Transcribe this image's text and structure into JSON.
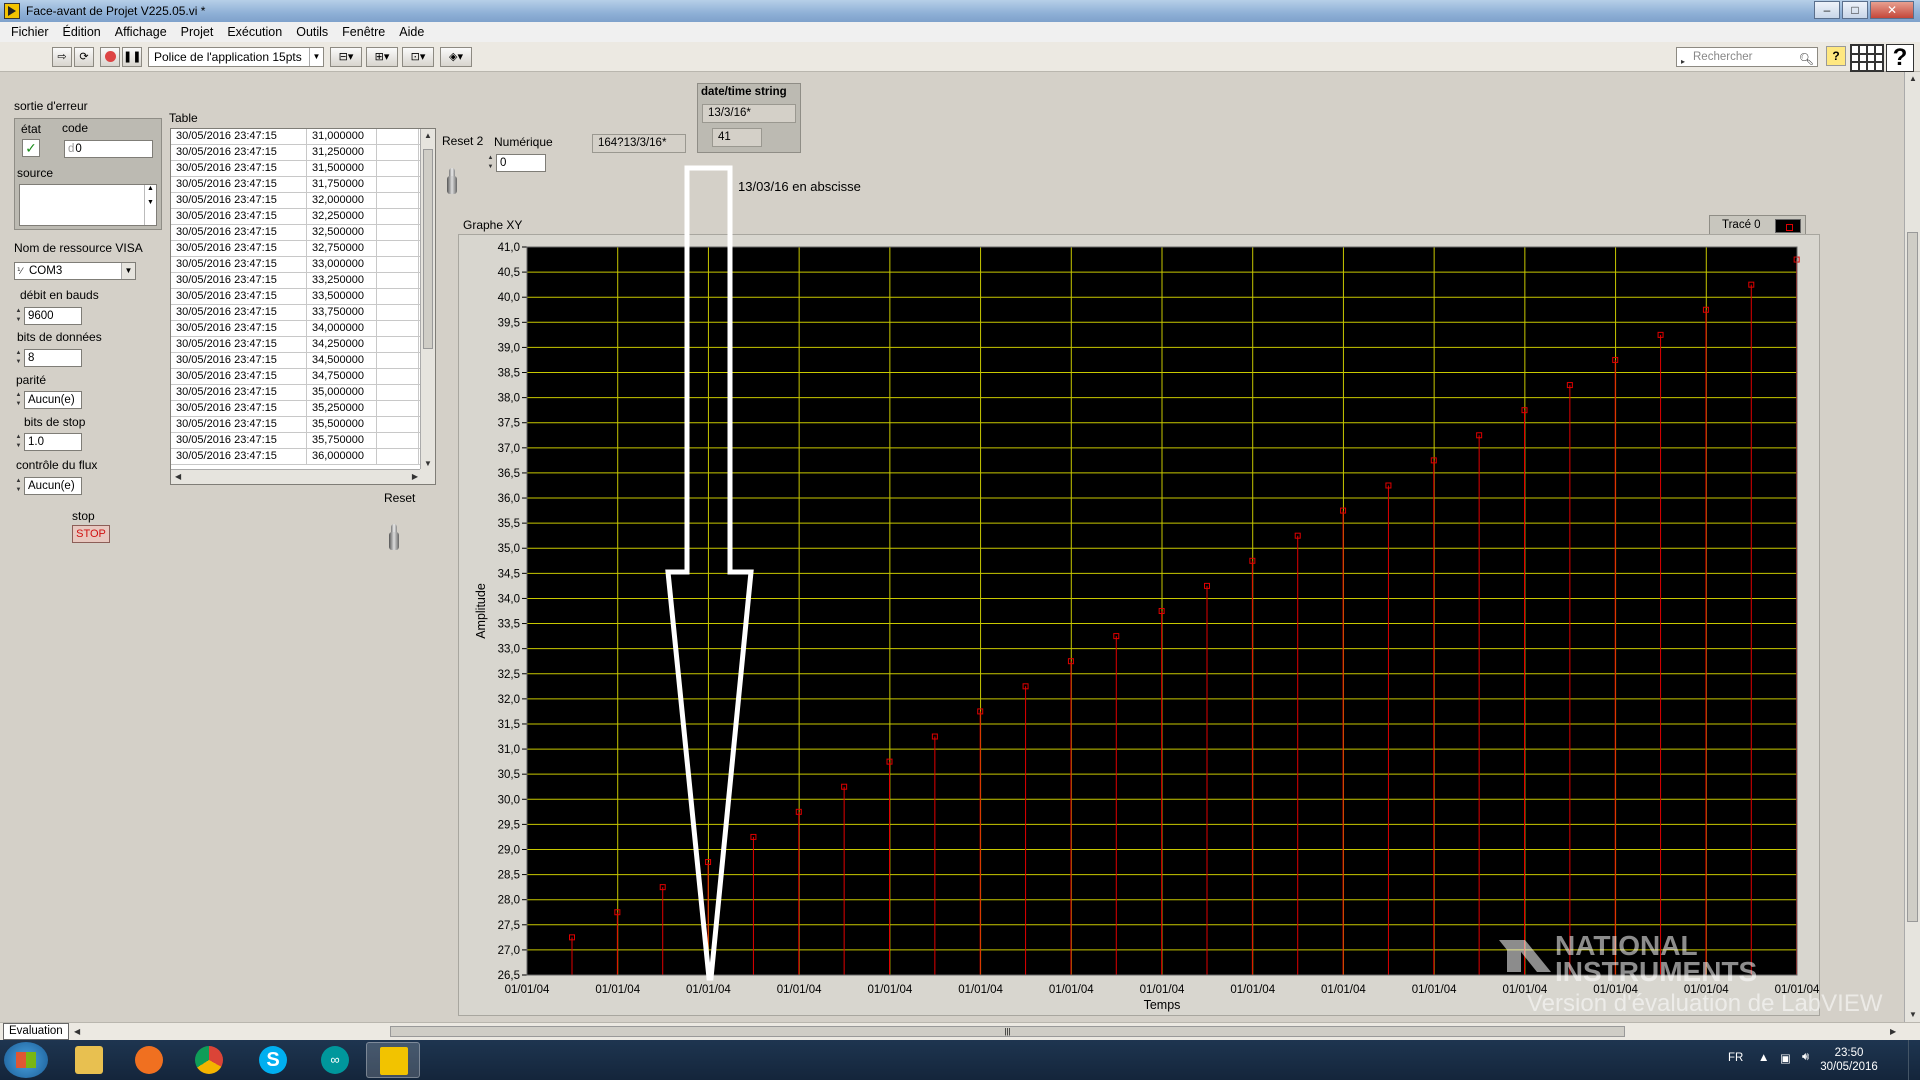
{
  "window": {
    "title": "Face-avant de Projet V225.05.vi *",
    "buttons": {
      "minimize": "–",
      "maximize": "□",
      "close": "✕"
    }
  },
  "menu": [
    "Fichier",
    "Édition",
    "Affichage",
    "Projet",
    "Exécution",
    "Outils",
    "Fenêtre",
    "Aide"
  ],
  "toolbar": {
    "font_select": "Police de l'application 15pts",
    "search_placeholder": "Rechercher",
    "help": "?"
  },
  "error_cluster": {
    "label": "sortie d'erreur",
    "status_label": "état",
    "code_label": "code",
    "code_value": "0",
    "source_label": "source"
  },
  "serial": {
    "visa_label": "Nom de ressource VISA",
    "visa_value": "COM3",
    "baud_label": "débit en bauds",
    "baud_value": "9600",
    "bits_label": "bits de données",
    "bits_value": "8",
    "parity_label": "parité",
    "parity_value": "Aucun(e)",
    "stop_label": "bits de stop",
    "stop_value": "1.0",
    "flow_label": "contrôle du flux",
    "flow_value": "Aucun(e)"
  },
  "stop": {
    "label": "stop",
    "button": "STOP"
  },
  "table": {
    "label": "Table",
    "rows": [
      [
        "30/05/2016 23:47:15",
        "31,000000"
      ],
      [
        "30/05/2016 23:47:15",
        "31,250000"
      ],
      [
        "30/05/2016 23:47:15",
        "31,500000"
      ],
      [
        "30/05/2016 23:47:15",
        "31,750000"
      ],
      [
        "30/05/2016 23:47:15",
        "32,000000"
      ],
      [
        "30/05/2016 23:47:15",
        "32,250000"
      ],
      [
        "30/05/2016 23:47:15",
        "32,500000"
      ],
      [
        "30/05/2016 23:47:15",
        "32,750000"
      ],
      [
        "30/05/2016 23:47:15",
        "33,000000"
      ],
      [
        "30/05/2016 23:47:15",
        "33,250000"
      ],
      [
        "30/05/2016 23:47:15",
        "33,500000"
      ],
      [
        "30/05/2016 23:47:15",
        "33,750000"
      ],
      [
        "30/05/2016 23:47:15",
        "34,000000"
      ],
      [
        "30/05/2016 23:47:15",
        "34,250000"
      ],
      [
        "30/05/2016 23:47:15",
        "34,500000"
      ],
      [
        "30/05/2016 23:47:15",
        "34,750000"
      ],
      [
        "30/05/2016 23:47:15",
        "35,000000"
      ],
      [
        "30/05/2016 23:47:15",
        "35,250000"
      ],
      [
        "30/05/2016 23:47:15",
        "35,500000"
      ],
      [
        "30/05/2016 23:47:15",
        "35,750000"
      ],
      [
        "30/05/2016 23:47:15",
        "36,000000"
      ]
    ]
  },
  "controls": {
    "reset2_label": "Reset 2",
    "numeric_label": "Numérique",
    "numeric_value": "0",
    "string_indicator": "164?13/3/16*",
    "reset_label": "Reset"
  },
  "datetime_cluster": {
    "label": "date/time string",
    "string_value": "13/3/16*",
    "number_value": "41"
  },
  "annotation": "13/03/16 en abscisse",
  "graph": {
    "label": "Graphe XY",
    "legend": "Tracé 0"
  },
  "chart_data": {
    "type": "scatter",
    "title": "Graphe XY",
    "xlabel": "Temps",
    "ylabel": "Amplitude",
    "ylim": [
      26.5,
      41.0
    ],
    "yticks": [
      "41,0",
      "40,5",
      "40,0",
      "39,5",
      "39,0",
      "38,5",
      "38,0",
      "37,5",
      "37,0",
      "36,5",
      "36,0",
      "35,5",
      "35,0",
      "34,5",
      "34,0",
      "33,5",
      "33,0",
      "32,5",
      "32,0",
      "31,5",
      "31,0",
      "30,5",
      "30,0",
      "29,5",
      "29,0",
      "28,5",
      "28,0",
      "27,5",
      "27,0",
      "26,5"
    ],
    "xticks": [
      "01/01/04",
      "01/01/04",
      "01/01/04",
      "01/01/04",
      "01/01/04",
      "01/01/04",
      "01/01/04",
      "01/01/04",
      "01/01/04",
      "01/01/04",
      "01/01/04",
      "01/01/04",
      "01/01/04",
      "01/01/04",
      "01/01/04"
    ],
    "grid": true,
    "legend_position": "top-right",
    "series": [
      {
        "name": "Tracé 0",
        "color": "#e00000",
        "values": [
          27.25,
          27.75,
          28.25,
          28.75,
          29.25,
          29.75,
          30.25,
          30.75,
          31.25,
          31.75,
          32.25,
          32.75,
          33.25,
          33.75,
          34.25,
          34.75,
          35.25,
          35.75,
          36.25,
          36.75,
          37.25,
          37.75,
          38.25,
          38.75,
          39.25,
          39.75,
          40.25,
          40.75
        ]
      }
    ],
    "colors": {
      "background": "#000000",
      "grid": "#c8c800",
      "marker": "#e00000"
    }
  },
  "watermark": {
    "line1": "NATIONAL",
    "line2": "INSTRUMENTS",
    "line3": "Version d'évaluation de LabVIEW"
  },
  "bottom": {
    "tab": "Evaluation"
  },
  "taskbar": {
    "lang": "FR",
    "time": "23:50",
    "date": "30/05/2016"
  }
}
